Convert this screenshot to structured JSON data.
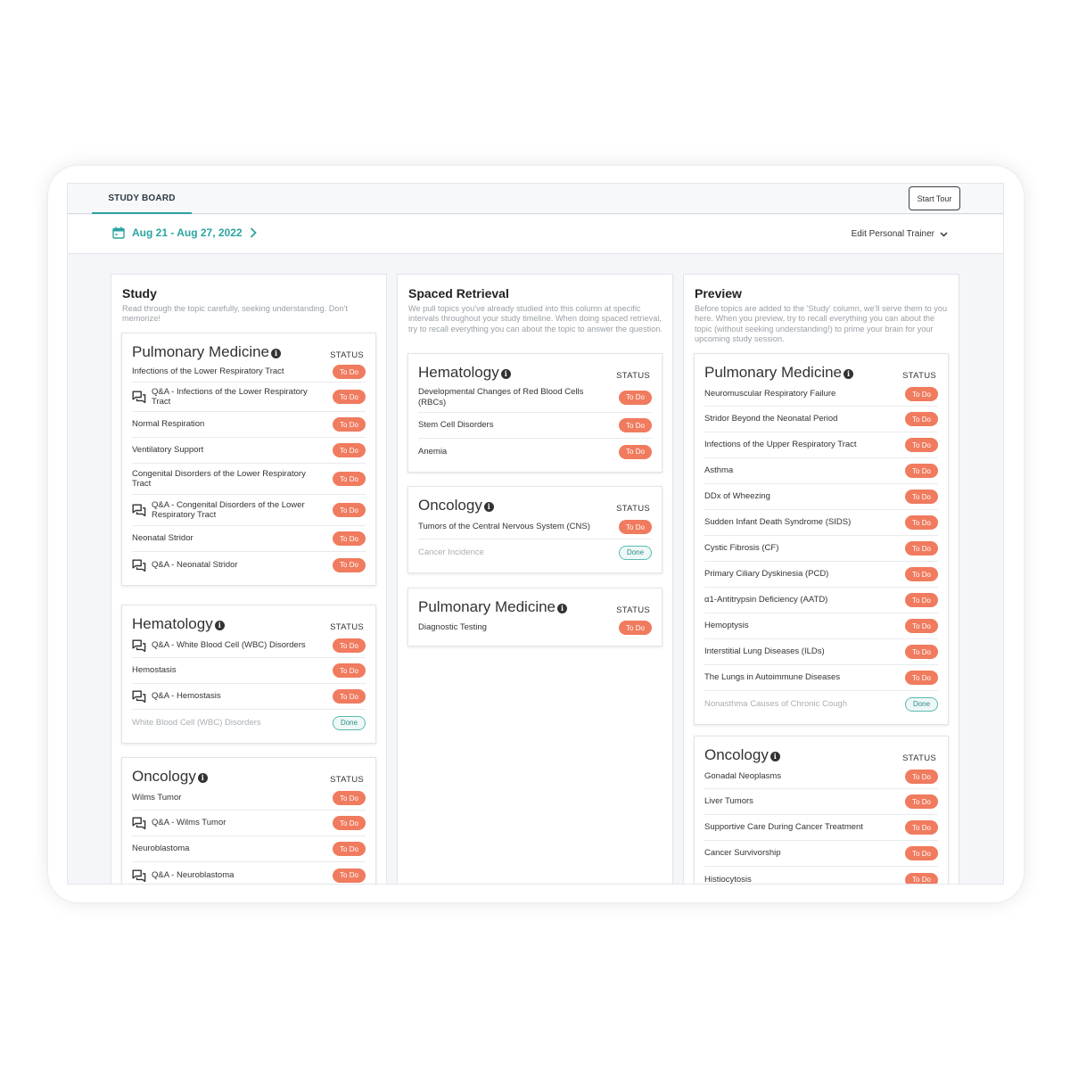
{
  "header": {
    "tab_label": "STUDY BOARD",
    "start_tour": "Start Tour",
    "date_range": "Aug 21 - Aug 27, 2022",
    "edit_trainer": "Edit Personal Trainer"
  },
  "colors": {
    "accent": "#2aa5a0",
    "todo": "#f07b5e"
  },
  "columns": [
    {
      "title": "Study",
      "description": "Read through the topic carefully, seeking understanding. Don't memorize!",
      "cards": [
        {
          "title": "Pulmonary Medicine",
          "status_label": "STATUS",
          "rows": [
            {
              "text": "Infections of the Lower Respiratory Tract",
              "qa": false,
              "status": "To Do"
            },
            {
              "text": "Q&A - Infections of the Lower Respiratory Tract",
              "qa": true,
              "status": "To Do"
            },
            {
              "text": "Normal Respiration",
              "qa": false,
              "status": "To Do"
            },
            {
              "text": "Ventilatory Support",
              "qa": false,
              "status": "To Do"
            },
            {
              "text": "Congenital Disorders of the Lower Respiratory Tract",
              "qa": false,
              "status": "To Do"
            },
            {
              "text": "Q&A - Congenital Disorders of the Lower Respiratory Tract",
              "qa": true,
              "status": "To Do"
            },
            {
              "text": "Neonatal Stridor",
              "qa": false,
              "status": "To Do"
            },
            {
              "text": "Q&A - Neonatal Stridor",
              "qa": true,
              "status": "To Do"
            }
          ]
        },
        {
          "title": "Hematology",
          "status_label": "STATUS",
          "rows": [
            {
              "text": "Q&A - White Blood Cell (WBC) Disorders",
              "qa": true,
              "status": "To Do"
            },
            {
              "text": "Hemostasis",
              "qa": false,
              "status": "To Do"
            },
            {
              "text": "Q&A - Hemostasis",
              "qa": true,
              "status": "To Do"
            },
            {
              "text": "White Blood Cell (WBC) Disorders",
              "qa": false,
              "status": "Done"
            }
          ]
        },
        {
          "title": "Oncology",
          "status_label": "STATUS",
          "rows": [
            {
              "text": "Wilms Tumor",
              "qa": false,
              "status": "To Do"
            },
            {
              "text": "Q&A - Wilms Tumor",
              "qa": true,
              "status": "To Do"
            },
            {
              "text": "Neuroblastoma",
              "qa": false,
              "status": "To Do"
            },
            {
              "text": "Q&A - Neuroblastoma",
              "qa": true,
              "status": "To Do"
            }
          ]
        }
      ]
    },
    {
      "title": "Spaced Retrieval",
      "description": "We pull topics you've already studied into this column at specific intervals throughout your study timeline. When doing spaced retrieval, try to recall everything you can about the topic to answer the question.",
      "cards": [
        {
          "title": "Hematology",
          "status_label": "STATUS",
          "rows": [
            {
              "text": "Developmental Changes of Red Blood Cells (RBCs)",
              "qa": false,
              "status": "To Do"
            },
            {
              "text": "Stem Cell Disorders",
              "qa": false,
              "status": "To Do"
            },
            {
              "text": "Anemia",
              "qa": false,
              "status": "To Do"
            }
          ]
        },
        {
          "title": "Oncology",
          "status_label": "STATUS",
          "rows": [
            {
              "text": "Tumors of the Central Nervous System (CNS)",
              "qa": false,
              "status": "To Do"
            },
            {
              "text": "Cancer Incidence",
              "qa": false,
              "status": "Done"
            }
          ]
        },
        {
          "title": "Pulmonary Medicine",
          "status_label": "STATUS",
          "rows": [
            {
              "text": "Diagnostic Testing",
              "qa": false,
              "status": "To Do"
            }
          ]
        }
      ]
    },
    {
      "title": "Preview",
      "description": "Before topics are added to the 'Study' column, we'll serve them to you here. When you preview, try to recall everything you can about the topic (without seeking understanding!) to prime your brain for your upcoming study session.",
      "cards": [
        {
          "title": "Pulmonary Medicine",
          "status_label": "STATUS",
          "rows": [
            {
              "text": "Neuromuscular Respiratory Failure",
              "qa": false,
              "status": "To Do"
            },
            {
              "text": "Stridor Beyond the Neonatal Period",
              "qa": false,
              "status": "To Do"
            },
            {
              "text": "Infections of the Upper Respiratory Tract",
              "qa": false,
              "status": "To Do"
            },
            {
              "text": "Asthma",
              "qa": false,
              "status": "To Do"
            },
            {
              "text": "DDx of Wheezing",
              "qa": false,
              "status": "To Do"
            },
            {
              "text": "Sudden Infant Death Syndrome (SIDS)",
              "qa": false,
              "status": "To Do"
            },
            {
              "text": "Cystic Fibrosis (CF)",
              "qa": false,
              "status": "To Do"
            },
            {
              "text": "Primary Ciliary Dyskinesia (PCD)",
              "qa": false,
              "status": "To Do"
            },
            {
              "text": "α1-Antitrypsin Deficiency (AATD)",
              "qa": false,
              "status": "To Do"
            },
            {
              "text": "Hemoptysis",
              "qa": false,
              "status": "To Do"
            },
            {
              "text": "Interstitial Lung Diseases (ILDs)",
              "qa": false,
              "status": "To Do"
            },
            {
              "text": "The Lungs in Autoimmune Diseases",
              "qa": false,
              "status": "To Do"
            },
            {
              "text": "Nonasthma Causes of Chronic Cough",
              "qa": false,
              "status": "Done"
            }
          ]
        },
        {
          "title": "Oncology",
          "status_label": "STATUS",
          "rows": [
            {
              "text": "Gonadal Neoplasms",
              "qa": false,
              "status": "To Do"
            },
            {
              "text": "Liver Tumors",
              "qa": false,
              "status": "To Do"
            },
            {
              "text": "Supportive Care During Cancer Treatment",
              "qa": false,
              "status": "To Do"
            },
            {
              "text": "Cancer Survivorship",
              "qa": false,
              "status": "To Do"
            },
            {
              "text": "Histiocytosis",
              "qa": false,
              "status": "To Do"
            }
          ]
        }
      ]
    }
  ]
}
